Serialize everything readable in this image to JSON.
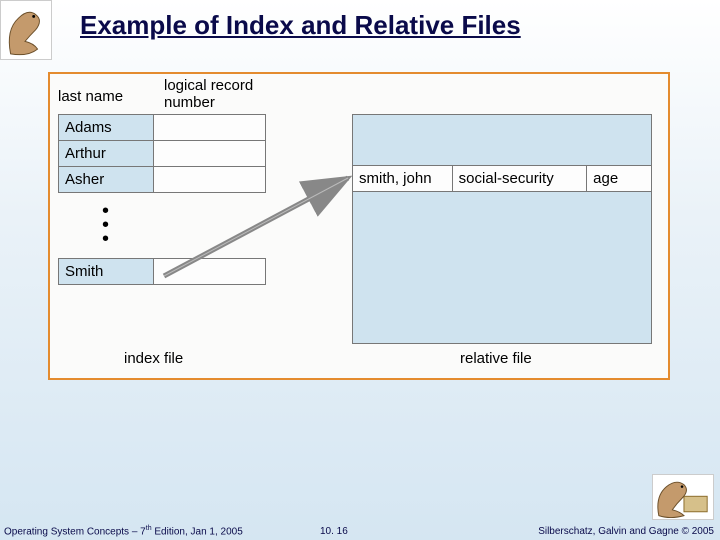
{
  "title": "Example of Index and Relative Files",
  "headers": {
    "last_name": "last name",
    "logical_record": "logical record",
    "number": "number"
  },
  "index_rows": [
    "Adams",
    "Arthur",
    "Asher"
  ],
  "smith_label": "Smith",
  "record": {
    "name": "smith, john",
    "field2": "social-security",
    "field3": "age"
  },
  "captions": {
    "index": "index file",
    "relative": "relative file"
  },
  "footer": {
    "left_a": "Operating System Concepts – 7",
    "left_sup": "th",
    "left_b": " Edition, Jan 1, 2005",
    "center": "10. 16",
    "right": "Silberschatz, Galvin and Gagne © 2005"
  }
}
